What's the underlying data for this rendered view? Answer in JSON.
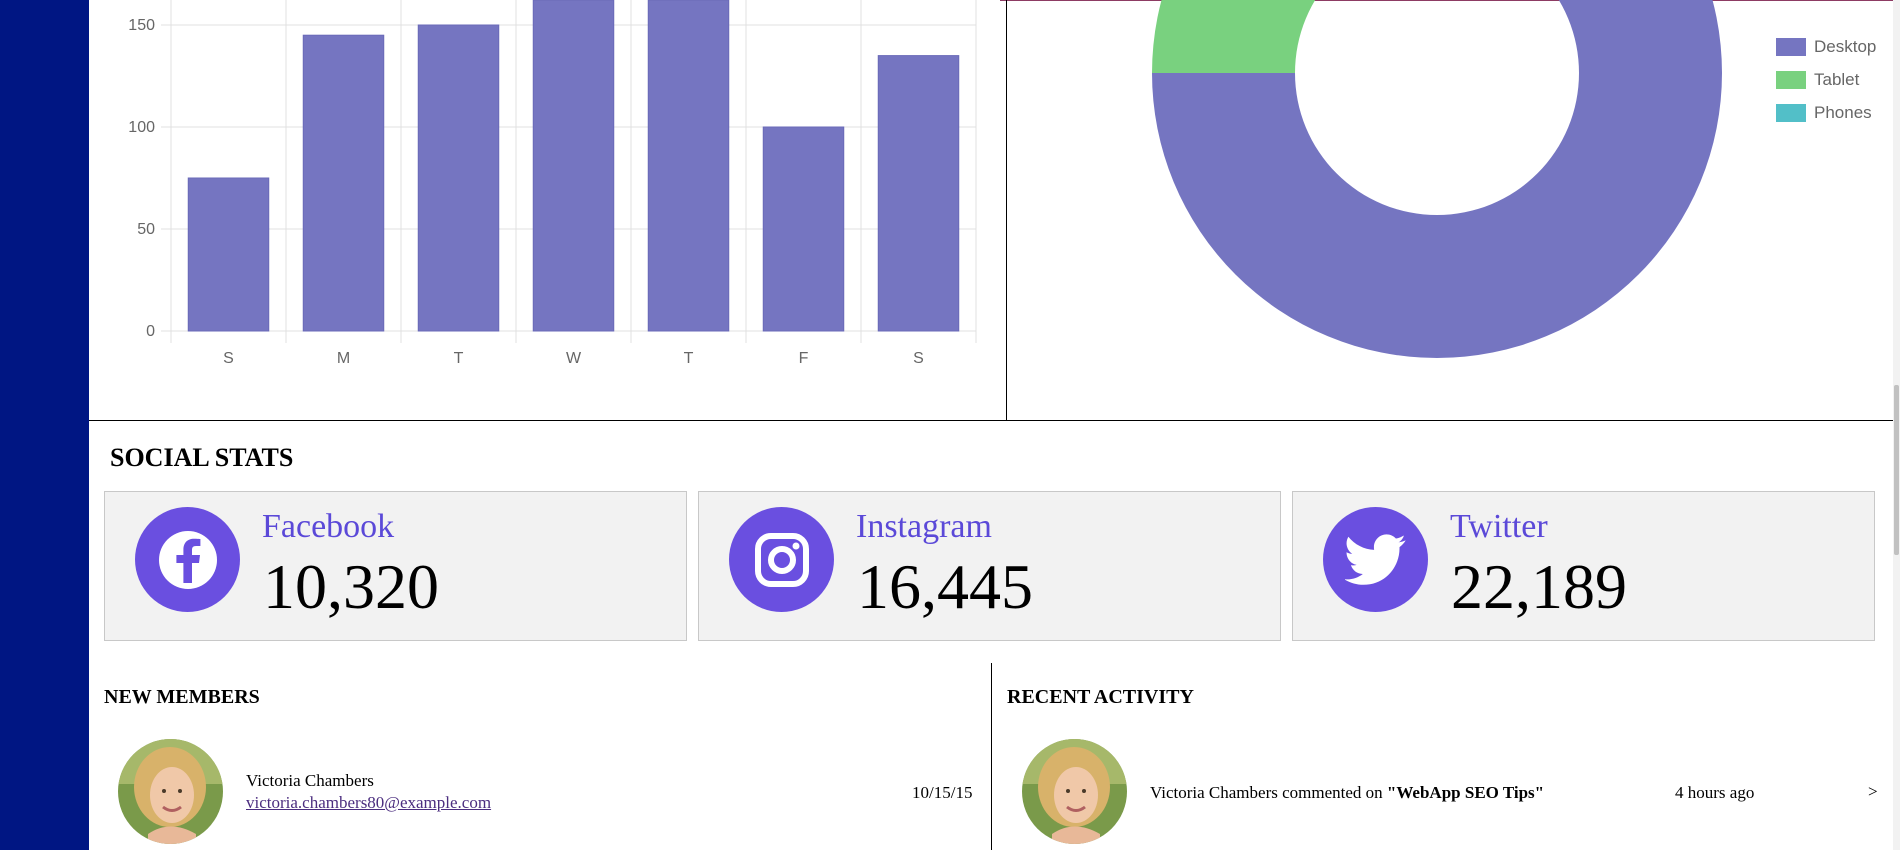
{
  "colors": {
    "sidebar": "#001683",
    "bar": "#7575c1",
    "donut_desktop": "#7575c1",
    "donut_tablet": "#79d17f",
    "donut_phones": "#52bfc8",
    "social_icon": "#6a4fe0",
    "social_name": "#5b49d8"
  },
  "bar_chart": {
    "type": "bar",
    "categories": [
      "S",
      "M",
      "T",
      "W",
      "T",
      "F",
      "S"
    ],
    "values": [
      75,
      145,
      150,
      200,
      200,
      100,
      135
    ],
    "y_ticks": [
      "0",
      "50",
      "100",
      "150"
    ],
    "ylim": [
      0,
      160
    ],
    "grid": true
  },
  "donut_chart": {
    "type": "pie",
    "variant": "donut",
    "labels": [
      "Desktop",
      "Tablet",
      "Phones"
    ],
    "values": [
      0.75,
      0.25,
      0
    ],
    "legend_position": "top-right"
  },
  "social_stats": {
    "title": "SOCIAL STATS",
    "cards": [
      {
        "name": "Facebook",
        "count": "10,320",
        "icon": "facebook-icon"
      },
      {
        "name": "Instagram",
        "count": "16,445",
        "icon": "instagram-icon"
      },
      {
        "name": "Twitter",
        "count": "22,189",
        "icon": "twitter-icon"
      }
    ]
  },
  "new_members": {
    "title": "NEW MEMBERS",
    "items": [
      {
        "name": "Victoria Chambers",
        "email": "victoria.chambers80@example.com",
        "date": "10/15/15"
      }
    ]
  },
  "recent_activity": {
    "title": "RECENT ACTIVITY",
    "items": [
      {
        "user": "Victoria Chambers",
        "action": "commented on",
        "target": "\"WebApp SEO Tips\"",
        "time": "4 hours ago",
        "arrow": ">"
      }
    ]
  }
}
